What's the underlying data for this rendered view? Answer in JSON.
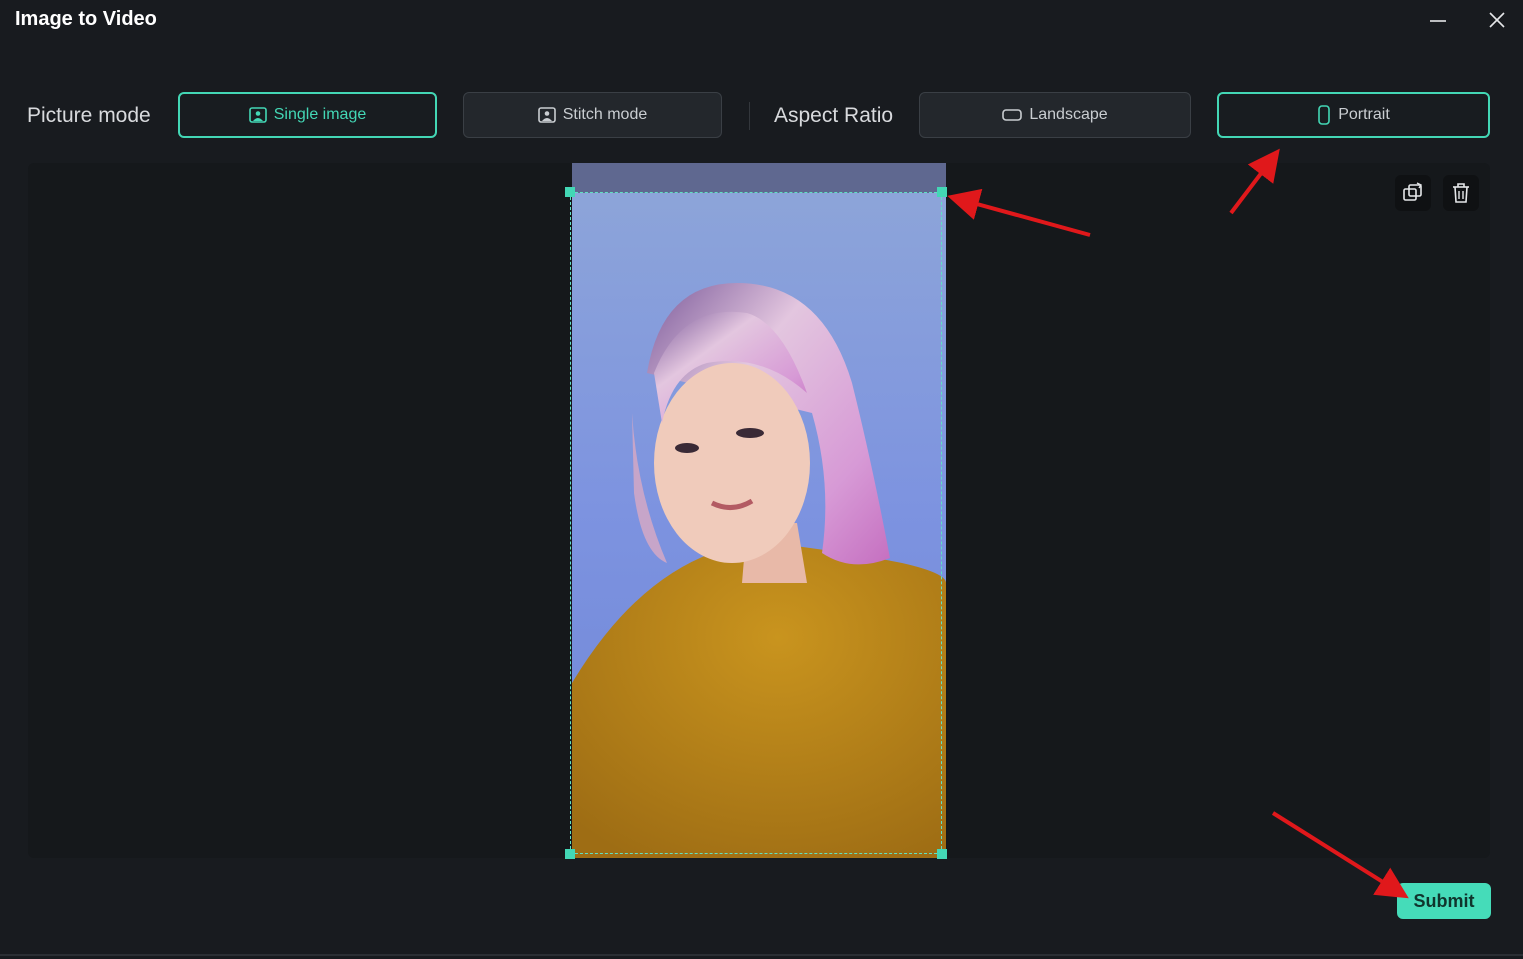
{
  "window": {
    "title": "Image to Video"
  },
  "picture_mode": {
    "label": "Picture mode",
    "options": [
      {
        "label": "Single image",
        "icon": "image-icon",
        "selected": true
      },
      {
        "label": "Stitch mode",
        "icon": "image-icon",
        "selected": false
      }
    ]
  },
  "aspect_ratio": {
    "label": "Aspect Ratio",
    "options": [
      {
        "label": "Landscape",
        "icon": "landscape-icon",
        "selected": false
      },
      {
        "label": "Portrait",
        "icon": "portrait-icon",
        "selected": true
      }
    ]
  },
  "preview": {
    "tools": [
      "replace-image-icon",
      "trash-icon"
    ]
  },
  "footer": {
    "submit_label": "Submit"
  },
  "colors": {
    "accent": "#43d7b5",
    "background": "#181b1f",
    "annotation": "#e0181b"
  }
}
